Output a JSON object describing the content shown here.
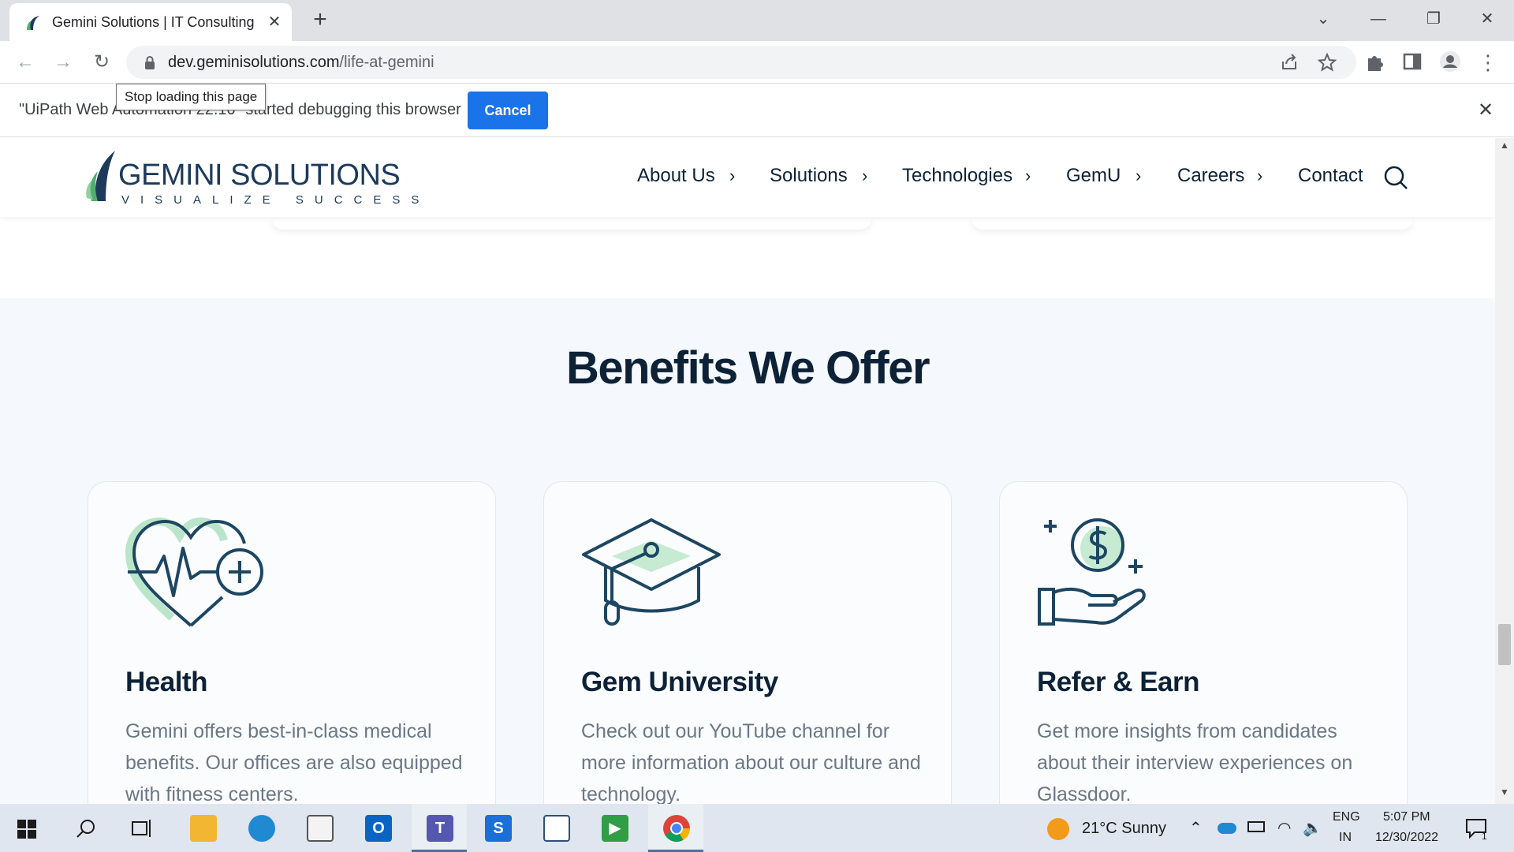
{
  "browser": {
    "tab_title": "Gemini Solutions | IT Consulting",
    "new_tab_glyph": "+",
    "tab_close_glyph": "✕",
    "url_host": "dev.geminisolutions.com",
    "url_path": "/life-at-gemini",
    "tooltip": "Stop loading this page",
    "debug_message": "\"UiPath Web Automation 22.10\" started debugging this browser",
    "cancel_label": "Cancel",
    "close_glyph": "✕"
  },
  "site": {
    "logo_word_1": "GEMINI",
    "logo_word_2": " SOLUTIONS",
    "logo_tagline": "VISUALIZE SUCCESS",
    "nav": [
      {
        "label": "About Us"
      },
      {
        "label": "Solutions"
      },
      {
        "label": "Technologies"
      },
      {
        "label": "GemU"
      },
      {
        "label": "Careers"
      },
      {
        "label": "Contact"
      }
    ],
    "chevron_glyph": "›"
  },
  "benefits": {
    "title": "Benefits We Offer",
    "cards": [
      {
        "title": "Health",
        "text": "Gemini offers best-in-class medical benefits. Our offices are also equipped with fitness centers.",
        "icon": "heart-plus-icon"
      },
      {
        "title": "Gem University",
        "text": "Check out our YouTube channel for more information about our culture and technology.",
        "icon": "graduation-cap-icon"
      },
      {
        "title": "Refer & Earn",
        "text": "Get more insights from candidates about their interview experiences on Glassdoor.",
        "icon": "hand-coin-icon"
      }
    ]
  },
  "taskbar": {
    "weather": "21°C  Sunny",
    "lang_1": "ENG",
    "lang_2": "IN",
    "time": "5:07 PM",
    "date": "12/30/2022",
    "notification_count": "1"
  },
  "colors": {
    "brand_navy": "#0d2236",
    "accent_green": "#5cbf7a",
    "chrome_blue": "#1a73e8"
  }
}
